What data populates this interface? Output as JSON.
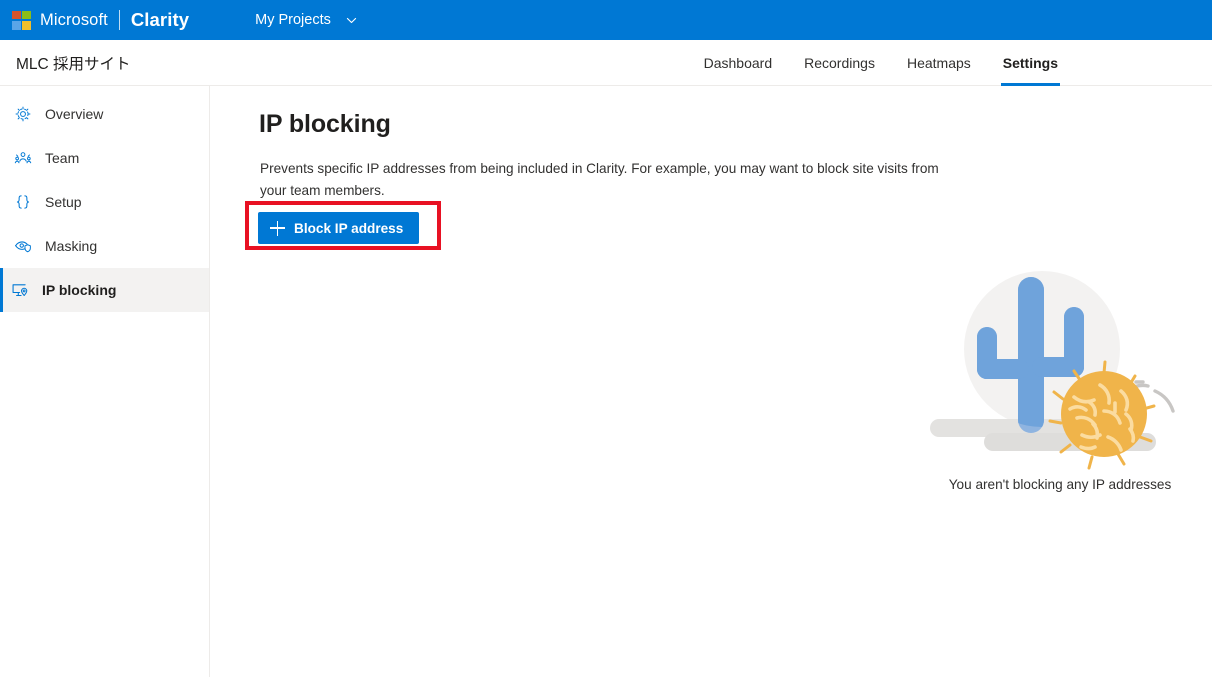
{
  "topbar": {
    "logo_icon": "microsoft-logo-icon",
    "microsoft": "Microsoft",
    "clarity": "Clarity",
    "projects_label": "My Projects",
    "chevron_icon": "chevron-down-icon",
    "background_color": "#0078D4"
  },
  "subheader": {
    "site_title": "MLC 採用サイト",
    "tabs": [
      {
        "label": "Dashboard",
        "active": false
      },
      {
        "label": "Recordings",
        "active": false
      },
      {
        "label": "Heatmaps",
        "active": false
      },
      {
        "label": "Settings",
        "active": true
      }
    ],
    "active_underline_color": "#0078D4"
  },
  "sidebar": {
    "items": [
      {
        "label": "Overview",
        "icon": "gear-icon",
        "active": false
      },
      {
        "label": "Team",
        "icon": "people-icon",
        "active": false
      },
      {
        "label": "Setup",
        "icon": "code-braces-icon",
        "active": false
      },
      {
        "label": "Masking",
        "icon": "eye-mask-icon",
        "active": false
      },
      {
        "label": "IP blocking",
        "icon": "ip-block-icon",
        "active": true
      }
    ],
    "active_background": "#F3F2F1",
    "active_border_color": "#0078D4",
    "icon_color": "#0078D4"
  },
  "main": {
    "title": "IP blocking",
    "description": "Prevents specific IP addresses from being included in Clarity. For example, you may want to block site visits from your team members.",
    "block_button": {
      "label": "Block IP address",
      "icon": "plus-icon",
      "background_color": "#0078D4"
    },
    "annotation": {
      "shape": "rectangle-highlight",
      "color": "#E81123"
    },
    "empty_state": {
      "caption": "You aren't blocking any IP addresses",
      "illustration": "cactus-tumbleweed-desert-illustration",
      "colors": {
        "cactus_light": "#8FB4E0",
        "cactus_dark": "#6FA3DB",
        "tumbleweed": "#F0B44A",
        "tumbleweed_strands": "#FBDCA0",
        "ground": "#DFDEDC",
        "backdrop_circle": "#F3F2F1",
        "trail": "#C8C6C4"
      }
    }
  }
}
